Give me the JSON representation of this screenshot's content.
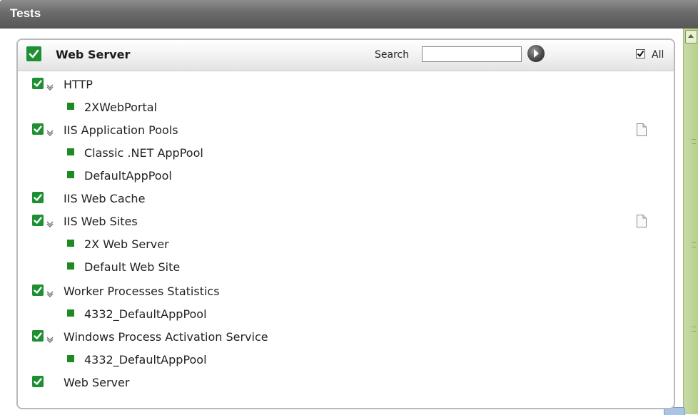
{
  "window": {
    "title": "Tests"
  },
  "panel": {
    "title": "Web Server",
    "search": {
      "label": "Search",
      "value": "",
      "placeholder": ""
    },
    "all_label": "All",
    "all_checked": true
  },
  "tree": [
    {
      "label": "HTTP",
      "checked": true,
      "expandable": true,
      "has_doc": false,
      "children": [
        "2XWebPortal"
      ]
    },
    {
      "label": "IIS Application Pools",
      "checked": true,
      "expandable": true,
      "has_doc": true,
      "children": [
        "Classic .NET AppPool",
        "DefaultAppPool"
      ]
    },
    {
      "label": "IIS Web Cache",
      "checked": true,
      "expandable": false,
      "has_doc": false,
      "children": []
    },
    {
      "label": "IIS Web Sites",
      "checked": true,
      "expandable": true,
      "has_doc": true,
      "children": [
        "2X Web Server",
        "Default Web Site"
      ]
    },
    {
      "label": "Worker Processes Statistics",
      "checked": true,
      "expandable": true,
      "has_doc": false,
      "children": [
        "4332_DefaultAppPool"
      ]
    },
    {
      "label": "Windows Process Activation Service",
      "checked": true,
      "expandable": true,
      "has_doc": false,
      "children": [
        "4332_DefaultAppPool"
      ]
    },
    {
      "label": "Web Server",
      "checked": true,
      "expandable": false,
      "has_doc": false,
      "children": []
    }
  ],
  "colors": {
    "check_green": "#1e8f33",
    "leaf_green": "#1e8a24",
    "title_bar": "#6a6a6a",
    "scroll_green": "#b5cf8a"
  }
}
